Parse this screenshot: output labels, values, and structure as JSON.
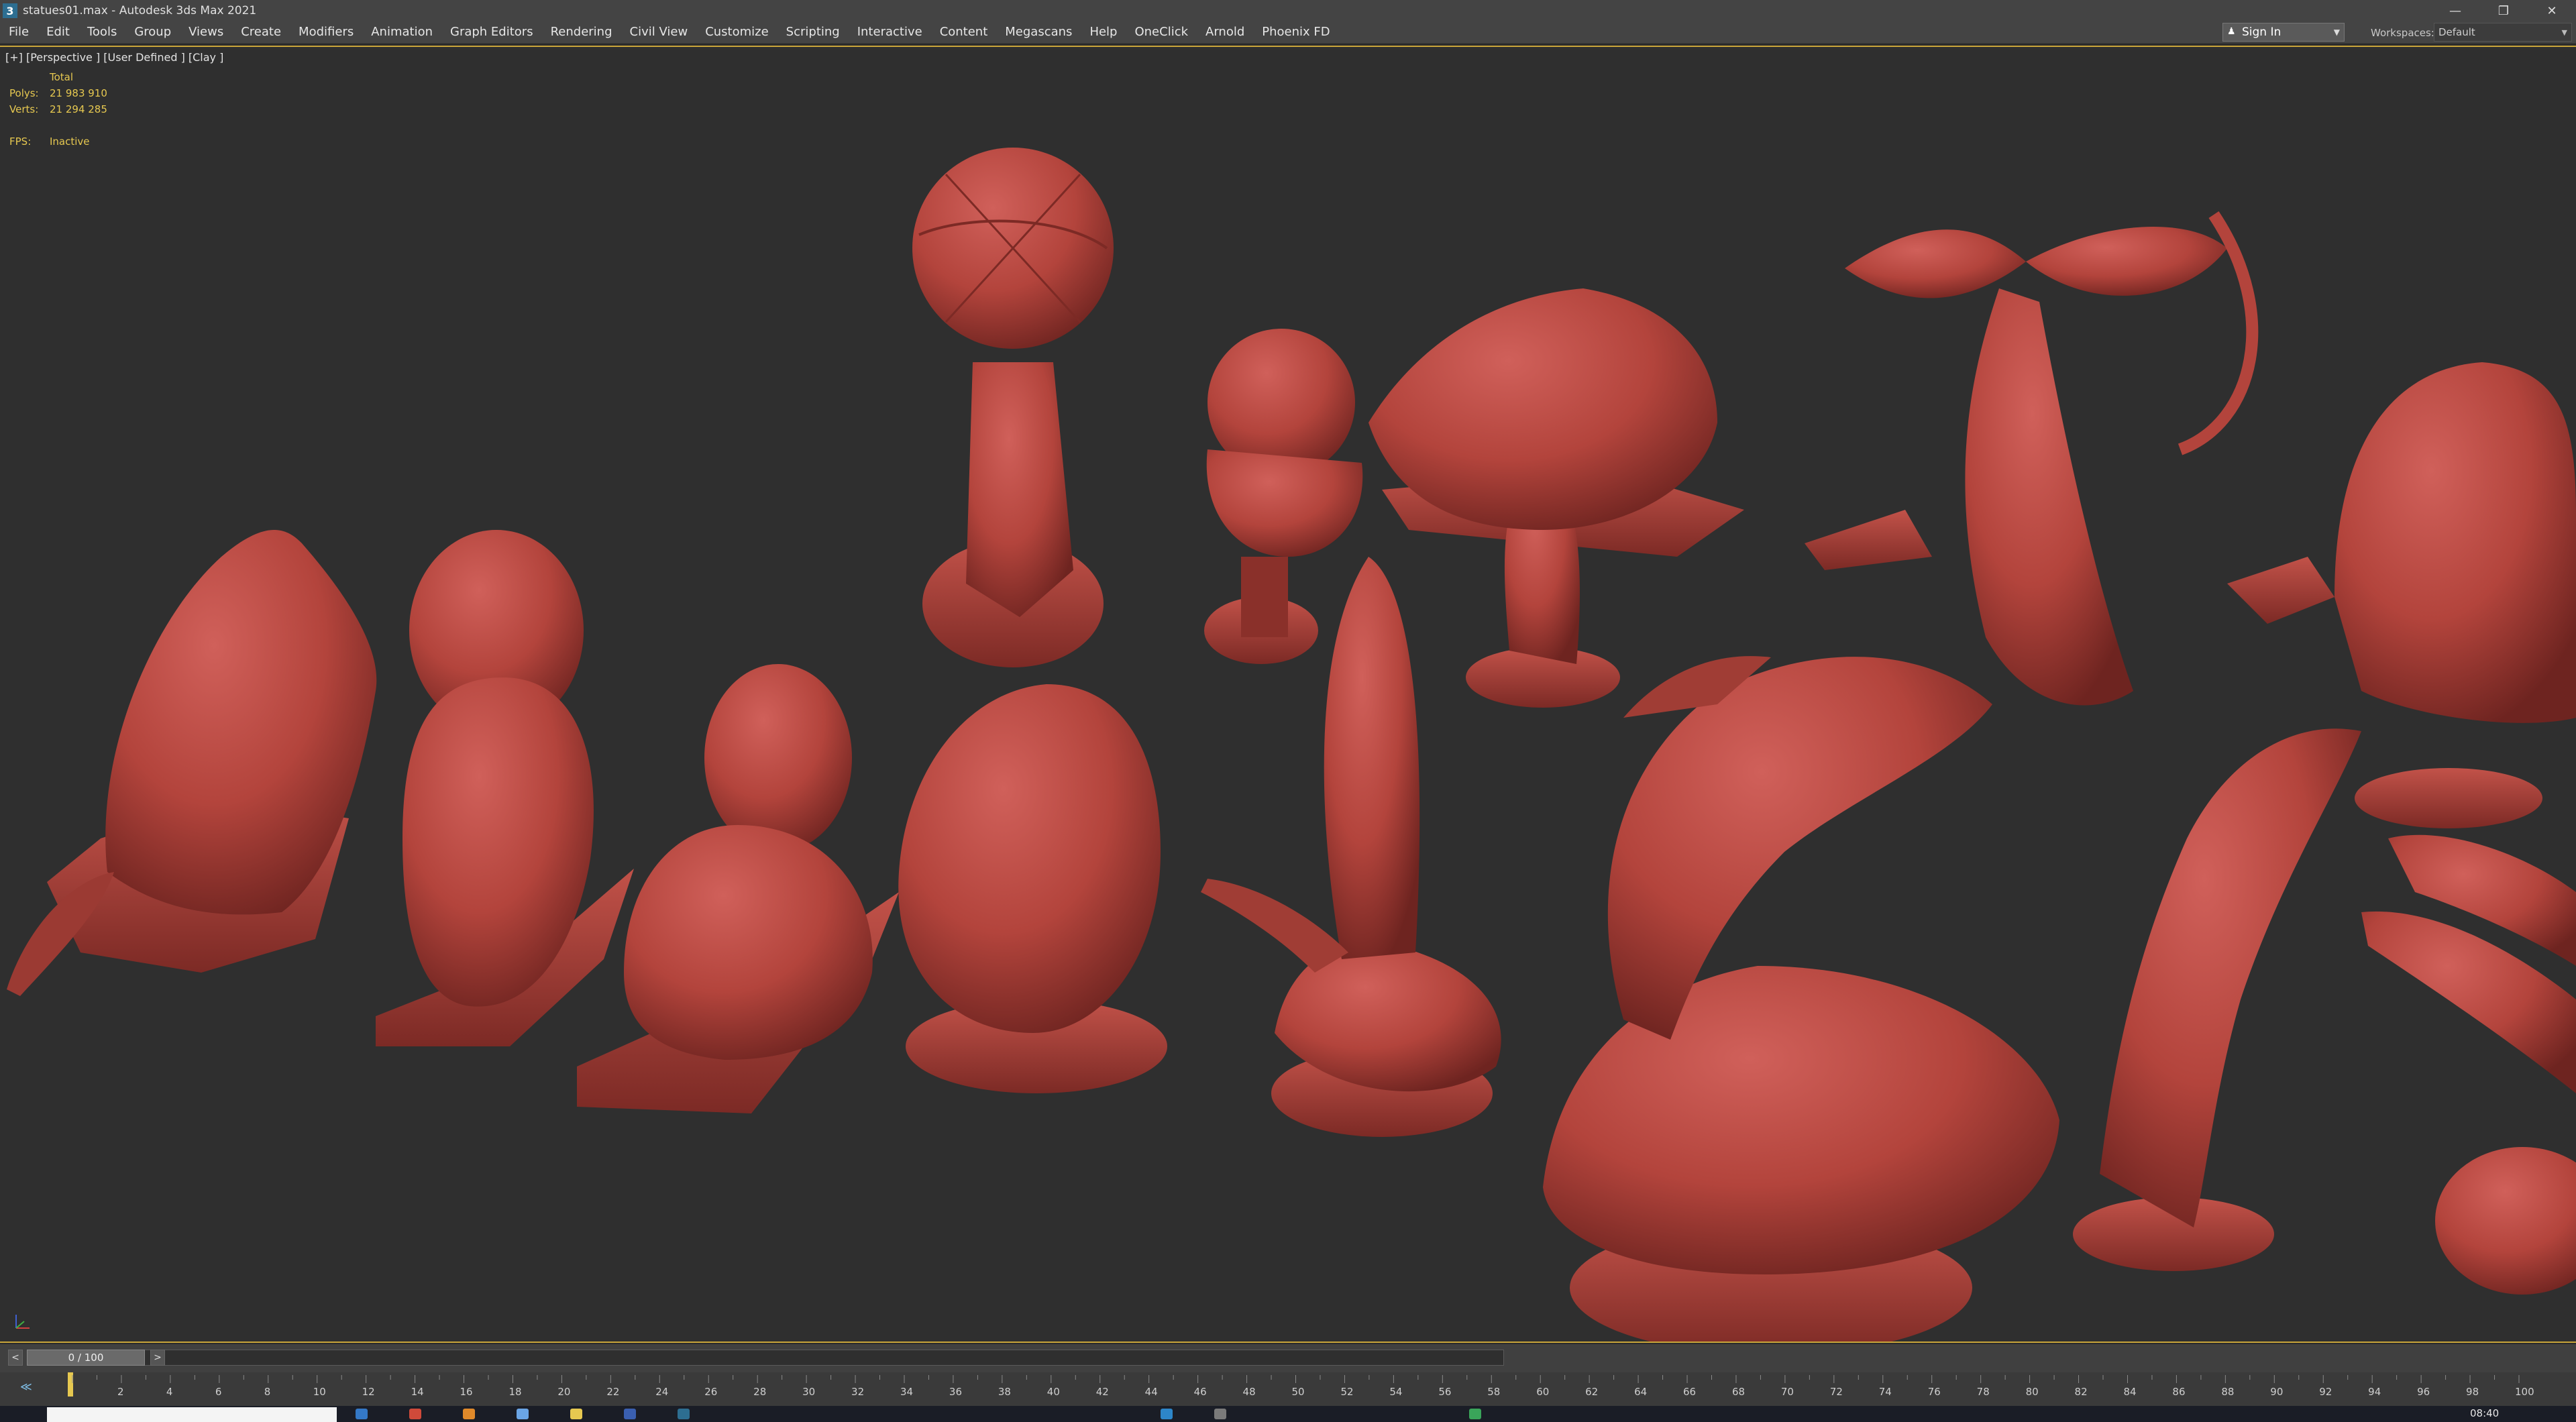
{
  "window": {
    "title": "statues01.max - Autodesk 3ds Max 2021",
    "app_icon": "3",
    "controls": [
      "minimize-icon",
      "restore-icon",
      "close-icon"
    ]
  },
  "menu": {
    "items": [
      "File",
      "Edit",
      "Tools",
      "Group",
      "Views",
      "Create",
      "Modifiers",
      "Animation",
      "Graph Editors",
      "Rendering",
      "Civil View",
      "Customize",
      "Scripting",
      "Interactive",
      "Content",
      "Megascans",
      "Help",
      "OneClick",
      "Arnold",
      "Phoenix FD"
    ],
    "sign_in": "Sign In",
    "workspaces_label": "Workspaces:",
    "workspaces_value": "Default"
  },
  "viewport": {
    "label": "[+] [Perspective ] [User Defined ] [Clay ]",
    "stats": {
      "total_header": "Total",
      "polys_label": "Polys:",
      "polys_value": "21 983 910",
      "verts_label": "Verts:",
      "verts_value": "21 294 285",
      "fps_label": "FPS:",
      "fps_value": "Inactive"
    },
    "clay_color": "#b5463d",
    "background_color": "#2f2f2f"
  },
  "time_slider": {
    "prev_label": "<",
    "next_label": ">",
    "frame_display": "0 / 100",
    "progress": 0
  },
  "trackbar": {
    "tick_labels": [
      "2",
      "4",
      "6",
      "8",
      "10",
      "12",
      "14",
      "16",
      "18",
      "20",
      "22",
      "24",
      "26",
      "28",
      "30",
      "32",
      "34",
      "36",
      "38",
      "40",
      "42",
      "44",
      "46",
      "48",
      "50",
      "52",
      "54",
      "56",
      "58",
      "60",
      "62",
      "64",
      "66",
      "68",
      "70",
      "72",
      "74",
      "76",
      "78",
      "80",
      "82",
      "84",
      "86",
      "88",
      "90",
      "92",
      "94",
      "96",
      "98",
      "100"
    ]
  },
  "taskbar": {
    "clock": "08:40"
  }
}
